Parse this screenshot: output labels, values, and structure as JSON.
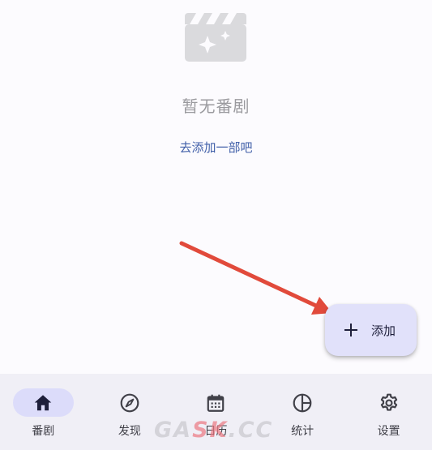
{
  "empty_state": {
    "icon": "movie-clapperboard-sparkle-icon",
    "title": "暂无番剧",
    "action_label": "去添加一部吧"
  },
  "annotation": {
    "arrow_color": "#e14a3b"
  },
  "fab": {
    "icon": "plus-icon",
    "label": "添加"
  },
  "bottom_nav": {
    "items": [
      {
        "label": "番剧",
        "icon": "home-icon",
        "active": true
      },
      {
        "label": "发现",
        "icon": "compass-icon",
        "active": false
      },
      {
        "label": "日历",
        "icon": "calendar-icon",
        "active": false
      },
      {
        "label": "统计",
        "icon": "pie-chart-icon",
        "active": false
      },
      {
        "label": "设置",
        "icon": "gear-icon",
        "active": false
      }
    ]
  },
  "watermark": {
    "part1": "GA",
    "part2": "SK",
    "part3": ".CC"
  },
  "colors": {
    "background": "#fcfbfe",
    "accent": "#3f5ea8",
    "fab_background": "#e1e1fa",
    "nav_background": "#f0eff6",
    "nav_active_pill": "#dcdcfa"
  }
}
